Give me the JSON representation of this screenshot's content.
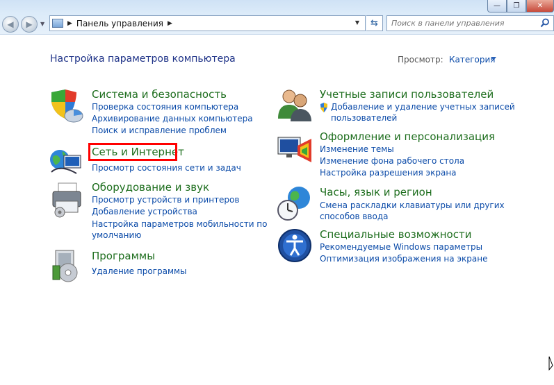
{
  "window": {
    "minimize": "—",
    "maximize": "❐",
    "close": "✕"
  },
  "address": {
    "path": "Панель управления"
  },
  "search": {
    "placeholder": "Поиск в панели управления"
  },
  "header": {
    "title": "Настройка параметров компьютера",
    "view_label": "Просмотр:",
    "view_value": "Категория"
  },
  "categories": {
    "system": {
      "title": "Система и безопасность",
      "links": [
        "Проверка состояния компьютера",
        "Архивирование данных компьютера",
        "Поиск и исправление проблем"
      ]
    },
    "network": {
      "title": "Сеть и Интернет",
      "links": [
        "Просмотр состояния сети и задач"
      ]
    },
    "hardware": {
      "title": "Оборудование и звук",
      "links": [
        "Просмотр устройств и принтеров",
        "Добавление устройства",
        "Настройка параметров мобильности по",
        "умолчанию"
      ]
    },
    "programs": {
      "title": "Программы",
      "links": [
        "Удаление программы"
      ]
    },
    "accounts": {
      "title": "Учетные записи пользователей",
      "links": [
        "Добавление и удаление учетных записей",
        "пользователей"
      ]
    },
    "appearance": {
      "title": "Оформление и персонализация",
      "links": [
        "Изменение темы",
        "Изменение фона рабочего стола",
        "Настройка разрешения экрана"
      ]
    },
    "clock": {
      "title": "Часы, язык и регион",
      "links": [
        "Смена раскладки клавиатуры или других",
        "способов ввода"
      ]
    },
    "access": {
      "title": "Специальные возможности",
      "links": [
        "Рекомендуемые Windows параметры",
        "Оптимизация изображения на экране"
      ]
    }
  }
}
